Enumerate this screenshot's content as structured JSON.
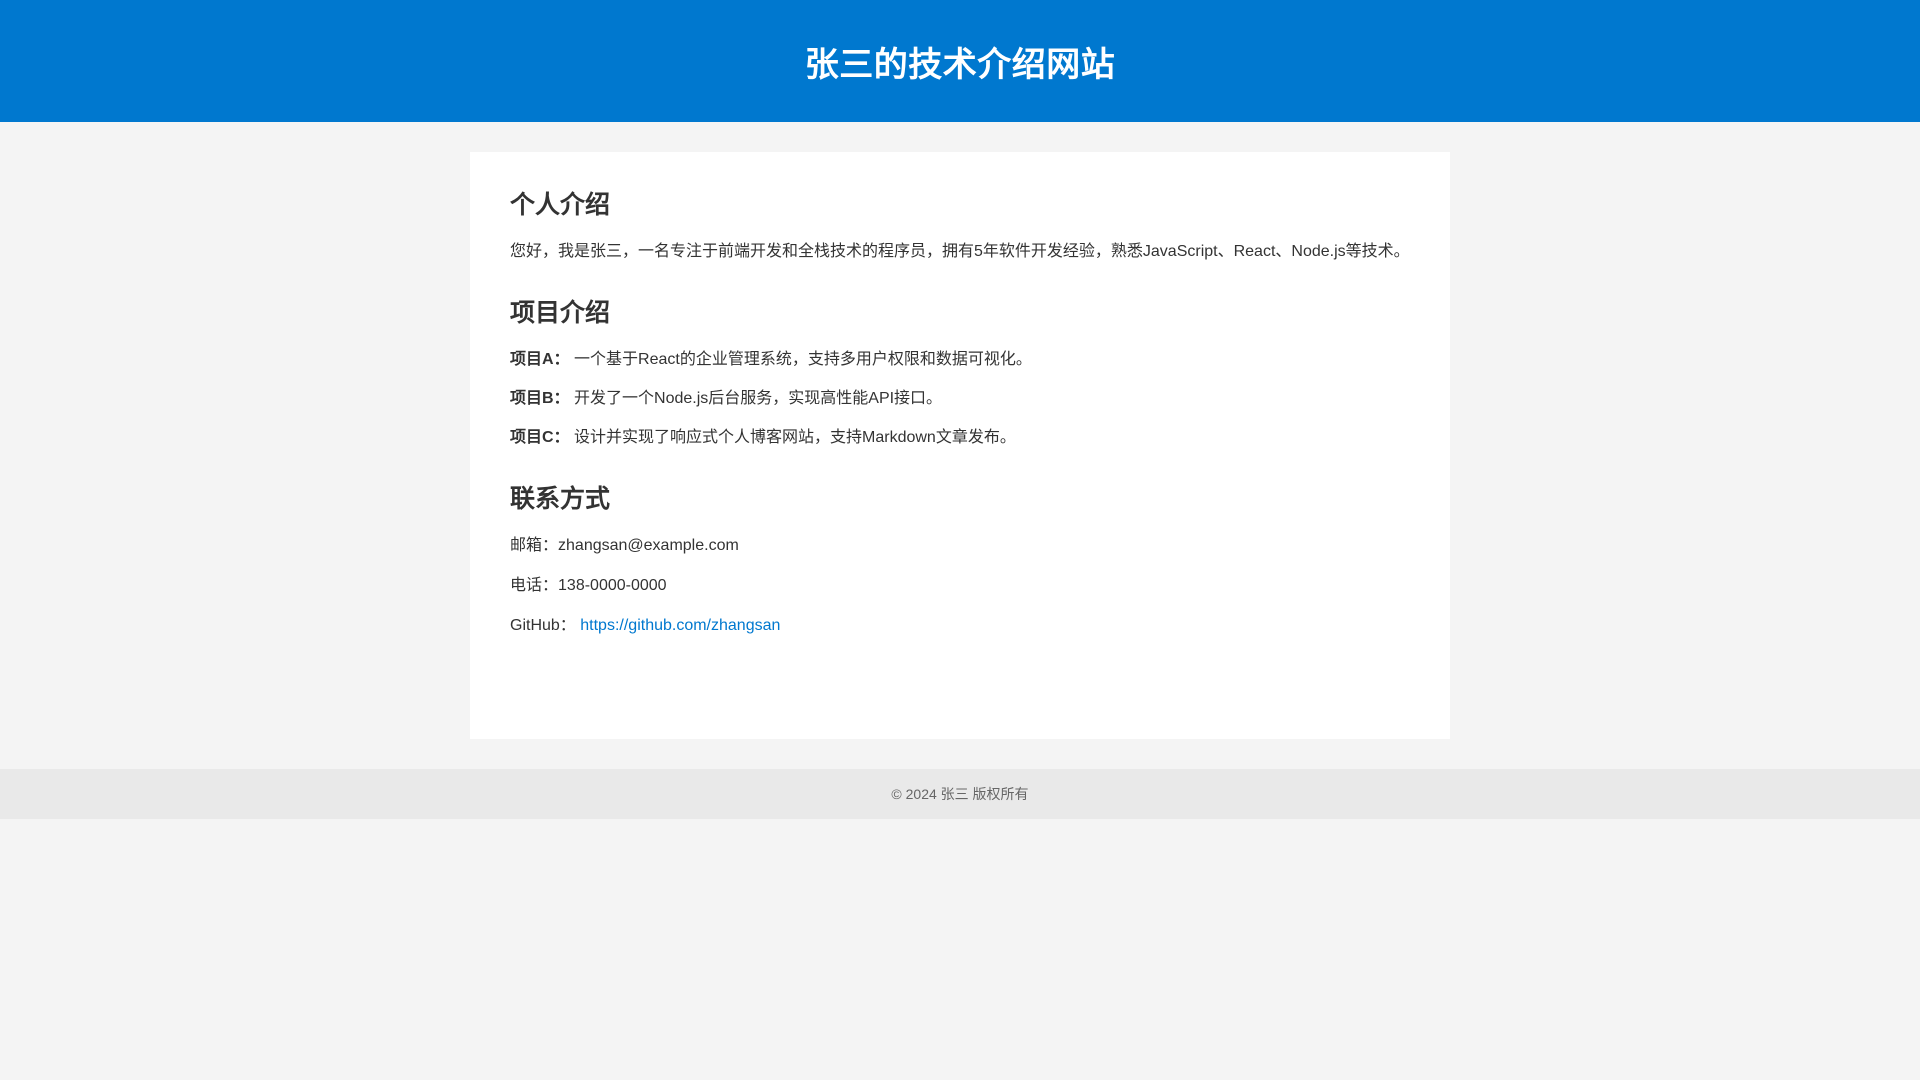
{
  "header": {
    "title": "张三的技术介绍网站"
  },
  "about": {
    "heading": "个人介绍",
    "text": "您好，我是张三，一名专注于前端开发和全栈技术的程序员，拥有5年软件开发经验，熟悉JavaScript、React、Node.js等技术。"
  },
  "projects": {
    "heading": "项目介绍",
    "items": [
      {
        "name": "项目A：",
        "desc": "一个基于React的企业管理系统，支持多用户权限和数据可视化。"
      },
      {
        "name": "项目B：",
        "desc": "开发了一个Node.js后台服务，实现高性能API接口。"
      },
      {
        "name": "项目C：",
        "desc": "设计并实现了响应式个人博客网站，支持Markdown文章发布。"
      }
    ]
  },
  "contact": {
    "heading": "联系方式",
    "email_label": "邮箱：",
    "email_value": "zhangsan@example.com",
    "phone_label": "电话：",
    "phone_value": "138-0000-0000",
    "github_label": "GitHub：",
    "github_link": "https://github.com/zhangsan"
  },
  "footer": {
    "text": "© 2024 张三 版权所有"
  },
  "colors": {
    "header_bg": "#0078cf",
    "link": "#0078cf",
    "page_bg": "#f4f4f4",
    "footer_bg": "#e9e9e9"
  }
}
